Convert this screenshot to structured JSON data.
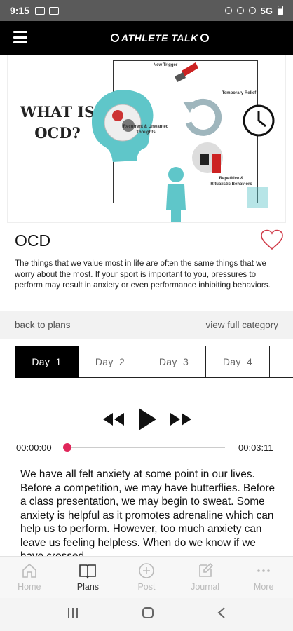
{
  "status_bar": {
    "time": "9:15",
    "network": "5G"
  },
  "header": {
    "logo_text": "ATHLETE TALK"
  },
  "hero": {
    "title": "WHAT IS OCD?",
    "labels": [
      "New Trigger",
      "Temporary Relief",
      "Recurrent & Unwanted Thoughts",
      "Repetitive & Ritualistic Behaviors"
    ]
  },
  "plan": {
    "title": "OCD",
    "description": "The things that we value most in life are often the same things that we worry about the most. If your sport is important to you, pressures to perform may result in anxiety or even performance inhibiting behaviors.",
    "back_link": "back to plans",
    "category_link": "view full category"
  },
  "days": [
    {
      "label": "Day",
      "num": "1"
    },
    {
      "label": "Day",
      "num": "2"
    },
    {
      "label": "Day",
      "num": "3"
    },
    {
      "label": "Day",
      "num": "4"
    }
  ],
  "player": {
    "elapsed": "00:00:00",
    "duration": "00:03:11",
    "progress": 0
  },
  "transcript": "We have all felt anxiety at some point in our lives. Before a competition, we may have butterflies. Before a class presentation, we may begin to sweat. Some anxiety is helpful as it promotes adrenaline which can help us to perform. However, too much anxiety can leave us feeling helpless. When do we know if we have crossed",
  "tabs": [
    {
      "label": "Home",
      "icon": "home-icon"
    },
    {
      "label": "Plans",
      "icon": "book-icon"
    },
    {
      "label": "Post",
      "icon": "plus-circle-icon"
    },
    {
      "label": "Journal",
      "icon": "edit-icon"
    },
    {
      "label": "More",
      "icon": "more-icon"
    }
  ],
  "colors": {
    "accent": "#e0265a",
    "header_bg": "#000000",
    "teal": "#5fc6c9"
  }
}
